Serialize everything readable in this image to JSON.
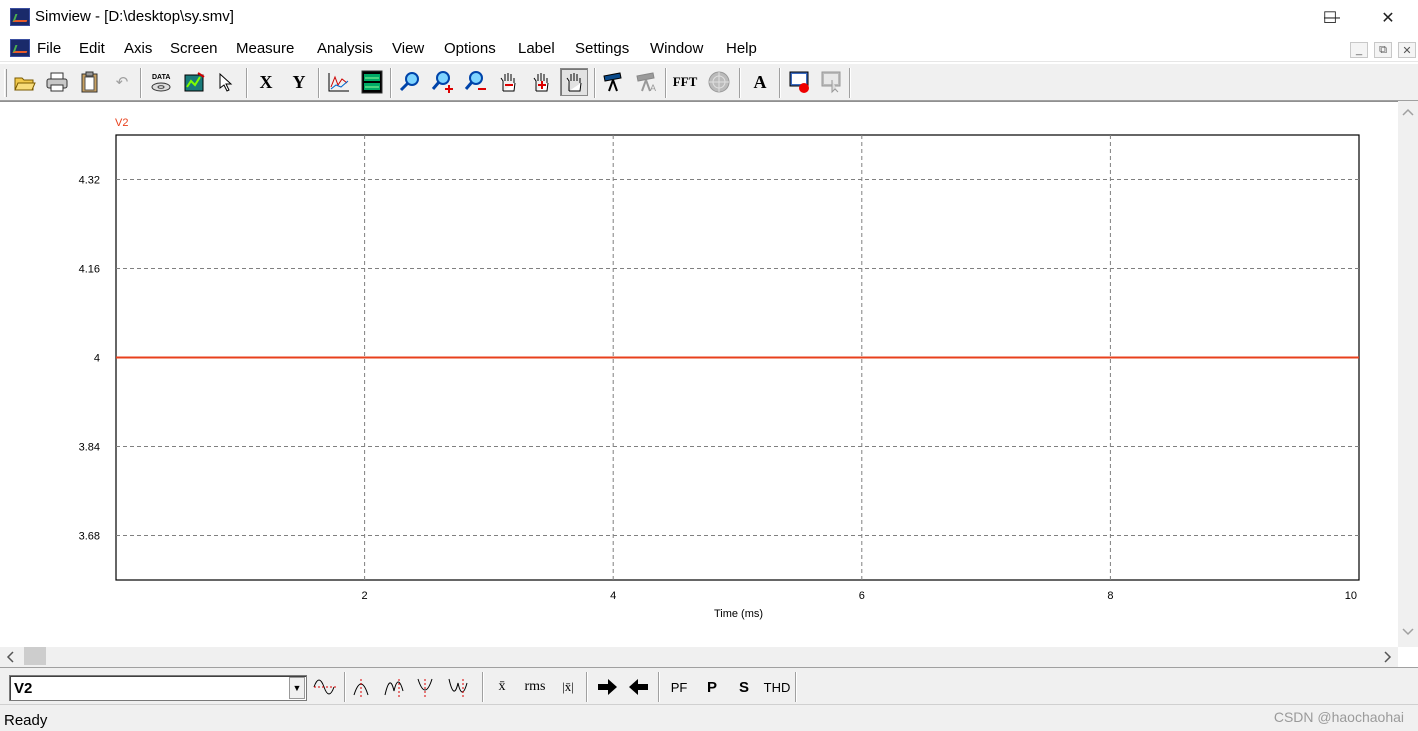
{
  "window": {
    "title": "Simview - [D:\\desktop\\sy.smv]",
    "minimize": "—",
    "maximize": "☐",
    "close": "✕"
  },
  "menu": {
    "items": [
      "File",
      "Edit",
      "Axis",
      "Screen",
      "Measure",
      "Analysis",
      "View",
      "Options",
      "Label",
      "Settings",
      "Window",
      "Help"
    ],
    "mdi": [
      "_",
      "⧉",
      "✕"
    ]
  },
  "toolbar": {
    "icons": [
      "open-icon",
      "print-icon",
      "clipboard-icon",
      "undo-icon",
      "data-icon",
      "add-curve-icon",
      "pointer-icon",
      "x-axis-icon",
      "y-axis-icon",
      "plot-icon",
      "screen-icon",
      "zoom-icon",
      "zoom-in-icon",
      "zoom-out-icon",
      "pan-icon",
      "pan-plus-icon",
      "hand-icon",
      "telescope-icon",
      "telescope-text-icon",
      "fft-icon",
      "circle-icon",
      "text-icon",
      "record-icon",
      "play-icon"
    ],
    "x_label": "X",
    "y_label": "Y",
    "fft_label": "FFT",
    "text_label": "A"
  },
  "chart_data": {
    "type": "line",
    "series": [
      {
        "name": "V2",
        "color": "#e8401c",
        "x": [
          0,
          10
        ],
        "y": [
          4,
          4
        ]
      }
    ],
    "xlabel": "Time (ms)",
    "ylabel": "",
    "xlim": [
      0,
      10
    ],
    "ylim": [
      3.6,
      4.4
    ],
    "xticks": [
      "2",
      "4",
      "6",
      "8",
      "10"
    ],
    "yticks": [
      "4.32",
      "4.16",
      "4",
      "3.84",
      "3.68"
    ],
    "grid": true
  },
  "bottombar": {
    "selected_curve": "V2",
    "mean_label": "x̄",
    "rms_label": "rms",
    "abs_label": "|x̄|",
    "pf_label": "PF",
    "p_label": "P",
    "s_label": "S",
    "thd_label": "THD"
  },
  "status": {
    "text": "Ready",
    "watermark": "CSDN @haochaohai"
  }
}
